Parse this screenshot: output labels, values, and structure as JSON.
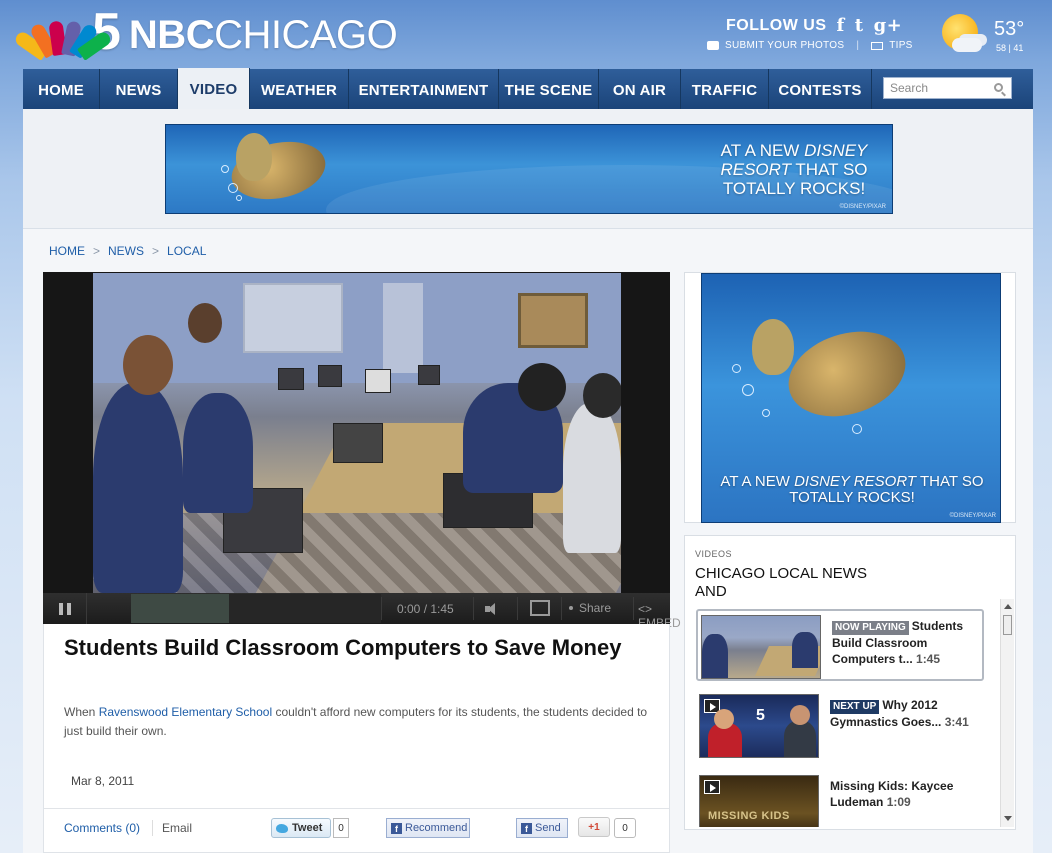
{
  "header": {
    "channel_number": "5",
    "brand_bold": "NBC",
    "brand_light": "CHICAGO",
    "follow_label": "FOLLOW US",
    "social": [
      "f",
      "t",
      "g+"
    ],
    "submit_photos": "SUBMIT YOUR PHOTOS",
    "tips": "TIPS",
    "weather": {
      "temp": "53°",
      "hi_lo": "58 | 41",
      "icon": "partly-sunny-icon"
    }
  },
  "nav": {
    "items": [
      "HOME",
      "NEWS",
      "VIDEO",
      "WEATHER",
      "ENTERTAINMENT",
      "THE SCENE",
      "ON AIR",
      "TRAFFIC",
      "CONTESTS"
    ],
    "active": "VIDEO",
    "search_placeholder": "Search"
  },
  "banner_ad": {
    "line1": "AT A NEW ",
    "line1_em": "DISNEY",
    "line2_em": "RESORT",
    "line2": " THAT SO",
    "line3": "TOTALLY ROCKS!",
    "credit": "©DISNEY/PIXAR"
  },
  "breadcrumb": [
    "HOME",
    "NEWS",
    "LOCAL"
  ],
  "player": {
    "time": "0:00 / 1:45",
    "progress_fraction": 0.0,
    "buffered_fraction": 0.39,
    "share_label": "Share",
    "embed_label": "<> EMBED"
  },
  "article": {
    "headline": "Students Build Classroom Computers to Save Money",
    "desc_pre": "When ",
    "desc_link": "Ravenswood Elementary School",
    "desc_post": " couldn't afford new computers for its students, the students decided to just build their own.",
    "date": "Mar 8, 2011",
    "comments": "Comments (0)",
    "email": "Email",
    "tweet": "Tweet",
    "tweet_count": "0",
    "recommend": "Recommend",
    "send": "Send",
    "plus_one": "+1",
    "plus_count": "0"
  },
  "right_ad": {
    "line1_pre": "AT A NEW ",
    "line1_em": "DISNEY RESORT",
    "line1_post": " THAT SO",
    "line2": "TOTALLY ROCKS!",
    "credit": "©DISNEY/PIXAR"
  },
  "videos": {
    "label": "VIDEOS",
    "title": "CHICAGO LOCAL NEWS AND",
    "items": [
      {
        "tag": "NOW PLAYING",
        "title": "Students Build Classroom Computers t...",
        "duration": "1:45"
      },
      {
        "tag": "NEXT UP",
        "title": "Why 2012 Gymnastics Goes...",
        "duration": "3:41"
      },
      {
        "tag": "",
        "title": "Missing Kids: Kaycee Ludeman",
        "duration": "1:09",
        "thumb_text": "MISSING KIDS"
      }
    ]
  },
  "colors": {
    "nav_bg": "#1b4479",
    "link": "#1f5ea8",
    "ad_blue": "#2d79c5"
  }
}
